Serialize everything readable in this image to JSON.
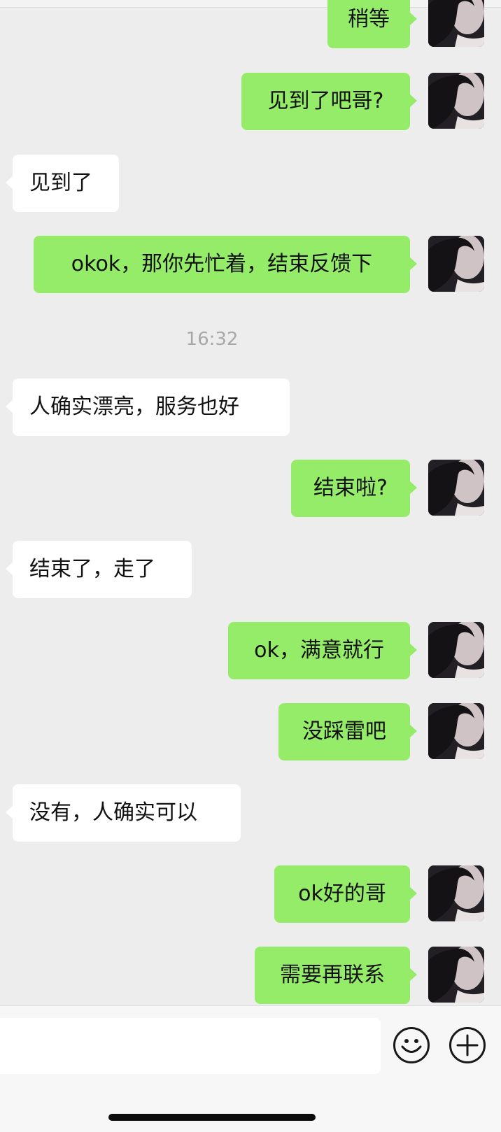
{
  "colors": {
    "background": "#ededed",
    "outgoing_bubble": "#95ec69",
    "incoming_bubble": "#ffffff",
    "timestamp_text": "#a8a8a8",
    "input_bar": "#f7f7f7"
  },
  "messages": [
    {
      "direction": "out",
      "text": "稍等"
    },
    {
      "direction": "out",
      "text": "见到了吧哥?"
    },
    {
      "direction": "in",
      "text": "见到了"
    },
    {
      "direction": "out",
      "text": "okok，那你先忙着，结束反馈下"
    },
    {
      "type": "time",
      "text": "16:32"
    },
    {
      "direction": "in",
      "text": "人确实漂亮，服务也好"
    },
    {
      "direction": "out",
      "text": "结束啦?"
    },
    {
      "direction": "in",
      "text": "结束了，走了"
    },
    {
      "direction": "out",
      "text": "ok，满意就行"
    },
    {
      "direction": "out",
      "text": "没踩雷吧"
    },
    {
      "direction": "in",
      "text": "没有，人确实可以"
    },
    {
      "direction": "out",
      "text": "ok好的哥"
    },
    {
      "direction": "out",
      "text": "需要再联系"
    }
  ],
  "input_bar": {
    "input_value": "",
    "emoji_icon": "emoji-icon",
    "plus_icon": "plus-icon"
  }
}
